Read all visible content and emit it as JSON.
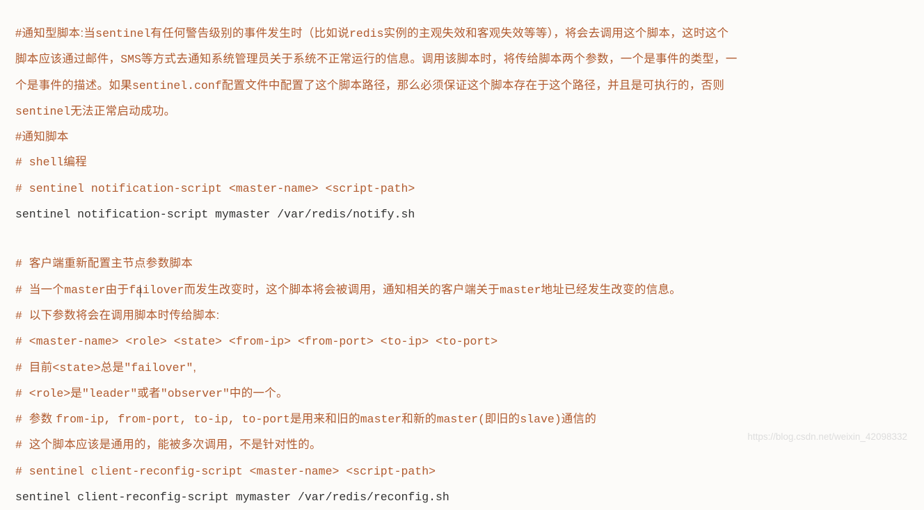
{
  "lines": [
    {
      "segments": [
        {
          "t": "#通知型脚本:当",
          "c": "zh-brown"
        },
        {
          "t": "sentinel",
          "c": "mono"
        },
        {
          "t": "有任何警告级别的事件发生时（比如说",
          "c": "zh-brown"
        },
        {
          "t": "redis",
          "c": "mono"
        },
        {
          "t": "实例的主观失效和客观失效等等），将会去调用这个脚本，这时这个",
          "c": "zh-brown"
        }
      ]
    },
    {
      "segments": [
        {
          "t": "脚本应该通过邮件，",
          "c": "zh-brown"
        },
        {
          "t": "SMS",
          "c": "mono"
        },
        {
          "t": "等方式去通知系统管理员关于系统不正常运行的信息。调用该脚本时，将传给脚本两个参数，一个是事件的类型，一",
          "c": "zh-brown"
        }
      ]
    },
    {
      "segments": [
        {
          "t": "个是事件的描述。如果",
          "c": "zh-brown"
        },
        {
          "t": "sentinel.conf",
          "c": "mono"
        },
        {
          "t": "配置文件中配置了这个脚本路径，那么必须保证这个脚本存在于这个路径，并且是可执行的，否则",
          "c": "zh-brown"
        }
      ]
    },
    {
      "segments": [
        {
          "t": "sentinel",
          "c": "mono"
        },
        {
          "t": "无法正常启动成功。",
          "c": "zh-brown"
        }
      ]
    },
    {
      "segments": [
        {
          "t": "#通知脚本",
          "c": "zh-brown"
        }
      ]
    },
    {
      "segments": [
        {
          "t": "# shell",
          "c": "mono"
        },
        {
          "t": "编程",
          "c": "zh-brown"
        }
      ]
    },
    {
      "segments": [
        {
          "t": "# sentinel notification-script <master-name> <script-path>",
          "c": "mono"
        }
      ]
    },
    {
      "segments": [
        {
          "t": "sentinel notification-script mymaster /var/redis/notify.sh",
          "c": "mono-dark"
        }
      ]
    },
    {
      "gap": true
    },
    {
      "segments": [
        {
          "t": "# ",
          "c": "mono"
        },
        {
          "t": "客户端重新配置主节点参数脚本",
          "c": "zh-brown"
        }
      ]
    },
    {
      "segments": [
        {
          "t": "# ",
          "c": "mono"
        },
        {
          "t": "当一个",
          "c": "zh-brown"
        },
        {
          "t": "master",
          "c": "mono"
        },
        {
          "t": "由于",
          "c": "zh-brown"
        },
        {
          "t": "failover",
          "c": "mono"
        },
        {
          "t": "而发生改变时，这个脚本将会被调用，通知相关的客户端关于",
          "c": "zh-brown"
        },
        {
          "t": "master",
          "c": "mono"
        },
        {
          "t": "地址已经发生改变的信息。",
          "c": "zh-brown"
        }
      ]
    },
    {
      "segments": [
        {
          "t": "# ",
          "c": "mono"
        },
        {
          "t": "以下参数将会在调用脚本时传给脚本:",
          "c": "zh-brown"
        }
      ]
    },
    {
      "segments": [
        {
          "t": "# <master-name> <role> <state> <from-ip> <from-port> <to-ip> <to-port>",
          "c": "mono"
        }
      ]
    },
    {
      "segments": [
        {
          "t": "# ",
          "c": "mono"
        },
        {
          "t": "目前",
          "c": "zh-brown"
        },
        {
          "t": "<state>",
          "c": "mono"
        },
        {
          "t": "总是",
          "c": "zh-brown"
        },
        {
          "t": "\"failover\"",
          "c": "mono"
        },
        {
          "t": ",",
          "c": "zh-brown"
        }
      ]
    },
    {
      "segments": [
        {
          "t": "# <role>",
          "c": "mono"
        },
        {
          "t": "是",
          "c": "zh-brown"
        },
        {
          "t": "\"leader\"",
          "c": "mono"
        },
        {
          "t": "或者",
          "c": "zh-brown"
        },
        {
          "t": "\"observer\"",
          "c": "mono"
        },
        {
          "t": "中的一个。",
          "c": "zh-brown"
        }
      ]
    },
    {
      "segments": [
        {
          "t": "# ",
          "c": "mono"
        },
        {
          "t": "参数 ",
          "c": "zh-brown"
        },
        {
          "t": "from-ip, from-port, to-ip, to-port",
          "c": "mono"
        },
        {
          "t": "是用来和旧的",
          "c": "zh-brown"
        },
        {
          "t": "master",
          "c": "mono"
        },
        {
          "t": "和新的",
          "c": "zh-brown"
        },
        {
          "t": "master(",
          "c": "mono"
        },
        {
          "t": "即旧的",
          "c": "zh-brown"
        },
        {
          "t": "slave)",
          "c": "mono"
        },
        {
          "t": "通信的",
          "c": "zh-brown"
        }
      ]
    },
    {
      "segments": [
        {
          "t": "# ",
          "c": "mono"
        },
        {
          "t": "这个脚本应该是通用的，能被多次调用，不是针对性的。",
          "c": "zh-brown"
        }
      ]
    },
    {
      "segments": [
        {
          "t": "# sentinel client-reconfig-script <master-name> <script-path>",
          "c": "mono"
        }
      ]
    },
    {
      "segments": [
        {
          "t": "sentinel client-reconfig-script mymaster /var/redis/reconfig.sh",
          "c": "mono-dark"
        }
      ]
    }
  ],
  "watermark": "https://blog.csdn.net/weixin_42098332"
}
